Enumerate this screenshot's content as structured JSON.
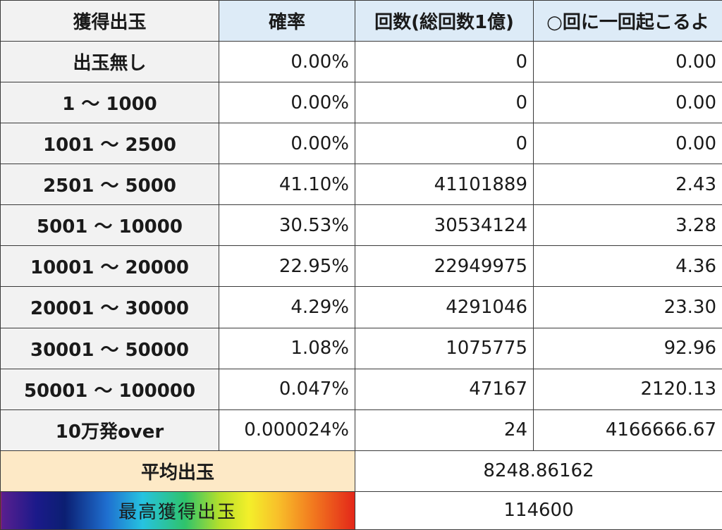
{
  "headers": {
    "col1": "獲得出玉",
    "col2": "確率",
    "col3": "回数(総回数1億)",
    "col4": "○回に一回起こるよ"
  },
  "rows": [
    {
      "label": "出玉無し",
      "prob": "0.00%",
      "count": "0",
      "every": "0.00"
    },
    {
      "label": "1 ～ 1000",
      "prob": "0.00%",
      "count": "0",
      "every": "0.00"
    },
    {
      "label": "1001 ～ 2500",
      "prob": "0.00%",
      "count": "0",
      "every": "0.00"
    },
    {
      "label": "2501 ～ 5000",
      "prob": "41.10%",
      "count": "41101889",
      "every": "2.43"
    },
    {
      "label": "5001 ～ 10000",
      "prob": "30.53%",
      "count": "30534124",
      "every": "3.28"
    },
    {
      "label": "10001 ～ 20000",
      "prob": "22.95%",
      "count": "22949975",
      "every": "4.36"
    },
    {
      "label": "20001 ～ 30000",
      "prob": "4.29%",
      "count": "4291046",
      "every": "23.30"
    },
    {
      "label": "30001 ～ 50000",
      "prob": "1.08%",
      "count": "1075775",
      "every": "92.96"
    },
    {
      "label": "50001 ～ 100000",
      "prob": "0.047%",
      "count": "47167",
      "every": "2120.13"
    },
    {
      "label": "10万発over",
      "prob": "0.000024%",
      "count": "24",
      "every": "4166666.67"
    }
  ],
  "summary": {
    "avg_label": "平均出玉",
    "avg_value": "8248.86162",
    "max_label": "最高獲得出玉",
    "max_value": "114600"
  },
  "colors": {
    "header_blue": "#ddebf7",
    "label_gray": "#f2f2f2",
    "avg_peach": "#fde9c6"
  }
}
